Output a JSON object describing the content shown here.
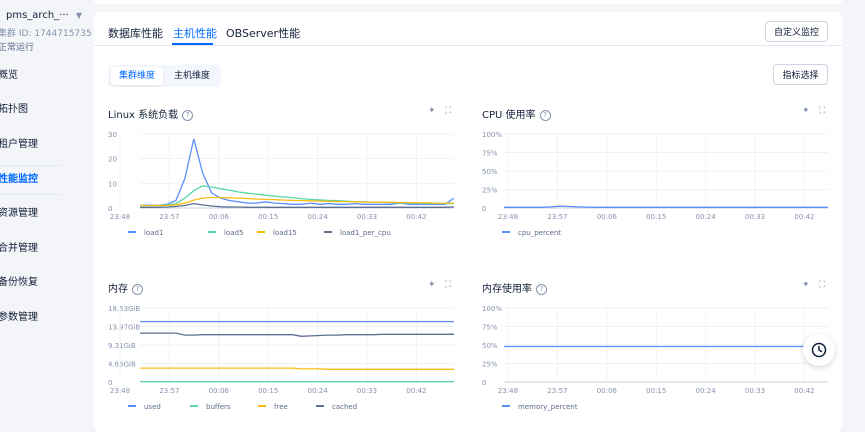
{
  "sidebar": {
    "cluster_name": "pms_arch_···",
    "cluster_id": "集群 ID: 1744715735",
    "cluster_status": "正常运行",
    "items": [
      {
        "label": "概览"
      },
      {
        "label": "拓扑图"
      },
      {
        "label": "租户管理"
      },
      {
        "label": "性能监控",
        "active": true
      },
      {
        "label": "资源管理"
      },
      {
        "label": "合并管理"
      },
      {
        "label": "备份恢复"
      },
      {
        "label": "参数管理"
      }
    ]
  },
  "tabs": {
    "db_perf": "数据库性能",
    "host_perf": "主机性能",
    "observer_perf": "OBServer性能"
  },
  "buttons": {
    "custom_monitor": "自定义监控",
    "metric_select": "指标选择"
  },
  "subtabs": {
    "cluster": "集群维度",
    "host": "主机维度"
  },
  "colors": {
    "accent": "#006aff",
    "series_blue": "#5b8ff9",
    "series_green": "#5ad8a6",
    "series_orange": "#f6bd16",
    "series_dark": "#5d7092"
  },
  "chart_data": [
    {
      "type": "line",
      "title": "Linux 系统负载",
      "x_ticks": [
        "23:48",
        "23:57",
        "00:06",
        "00:15",
        "00:24",
        "00:33",
        "00:42"
      ],
      "y_ticks": [
        "30",
        "20",
        "10",
        "0"
      ],
      "ylim": [
        0,
        30
      ],
      "series": [
        {
          "name": "load1",
          "color": "#5b8ff9",
          "values": [
            1,
            1.2,
            1,
            1.5,
            3,
            12,
            28,
            14,
            6,
            4,
            3,
            2.5,
            2,
            2,
            2.5,
            2,
            1.8,
            1.5,
            1.5,
            2,
            1.5,
            1.8,
            1.5,
            1.5,
            1.8,
            1.5,
            1.5,
            1.5,
            1.5,
            2,
            1.5,
            1.5,
            1.5,
            1.5,
            1.5,
            4
          ]
        },
        {
          "name": "load5",
          "color": "#5ad8a6",
          "values": [
            1,
            1,
            1,
            1.2,
            1.8,
            4,
            7,
            9,
            8.5,
            7.8,
            7.2,
            6.5,
            6,
            5.6,
            5.2,
            4.8,
            4.5,
            4.2,
            3.8,
            3.5,
            3.3,
            3.1,
            3,
            2.8,
            2.6,
            2.5,
            2.4,
            2.3,
            2.2,
            2.1,
            2,
            2,
            1.9,
            1.9,
            1.8,
            1.8
          ]
        },
        {
          "name": "load15",
          "color": "#f6bd16",
          "values": [
            1,
            1,
            1,
            1,
            1.3,
            2,
            3.2,
            4,
            4.3,
            4.2,
            4.1,
            4,
            3.8,
            3.6,
            3.5,
            3.4,
            3.2,
            3.1,
            3,
            2.9,
            2.8,
            2.7,
            2.6,
            2.6,
            2.5,
            2.4,
            2.4,
            2.3,
            2.3,
            2.2,
            2.2,
            2.1,
            2.1,
            2,
            2,
            2
          ]
        },
        {
          "name": "load1_per_cpu",
          "color": "#5d7092",
          "values": [
            0.3,
            0.3,
            0.3,
            0.4,
            0.6,
            1,
            1.8,
            1.2,
            0.8,
            0.5,
            0.4,
            0.4,
            0.3,
            0.3,
            0.3,
            0.3,
            0.3,
            0.3,
            0.3,
            0.3,
            0.3,
            0.3,
            0.3,
            0.3,
            0.3,
            0.3,
            0.3,
            0.3,
            0.3,
            0.3,
            0.3,
            0.3,
            0.3,
            0.3,
            0.3,
            0.4
          ]
        }
      ]
    },
    {
      "type": "line",
      "title": "CPU 使用率",
      "x_ticks": [
        "23:48",
        "23:57",
        "00:06",
        "00:15",
        "00:24",
        "00:33",
        "00:42"
      ],
      "y_ticks": [
        "100%",
        "75%",
        "50%",
        "25%",
        "0"
      ],
      "ylim": [
        0,
        100
      ],
      "series": [
        {
          "name": "cpu_percent",
          "color": "#5b8ff9",
          "values": [
            1,
            1,
            1,
            1,
            1,
            1.5,
            2.5,
            2,
            1.5,
            1.2,
            1,
            1,
            1,
            1,
            1,
            1,
            1,
            1,
            1,
            1,
            1,
            1,
            1,
            1,
            1,
            1,
            1,
            1,
            1,
            1,
            1,
            1,
            1,
            1,
            1,
            1
          ]
        }
      ]
    },
    {
      "type": "line",
      "title": "内存",
      "x_ticks": [
        "23:48",
        "23:57",
        "00:06",
        "00:15",
        "00:24",
        "00:33",
        "00:42"
      ],
      "y_ticks": [
        "18.63GiB",
        "13.97GiB",
        "9.31GiB",
        "4.66GiB",
        "0"
      ],
      "ylim": [
        0,
        18.63
      ],
      "series": [
        {
          "name": "used",
          "color": "#5b8ff9",
          "values": [
            15.2,
            15.2,
            15.2,
            15.2,
            15.2,
            15.2,
            15.2,
            15.2,
            15.2,
            15.2,
            15.2,
            15.2,
            15.2,
            15.2,
            15.2,
            15.2,
            15.2,
            15.2,
            15.2,
            15.2,
            15.2,
            15.2,
            15.2,
            15.2,
            15.2,
            15.2,
            15.2,
            15.2,
            15.2,
            15.2,
            15.2,
            15.2,
            15.2,
            15.2,
            15.2,
            15.2
          ]
        },
        {
          "name": "buffers",
          "color": "#5ad8a6",
          "values": [
            0.1,
            0.1,
            0.1,
            0.1,
            0.1,
            0.1,
            0.1,
            0.1,
            0.1,
            0.1,
            0.1,
            0.1,
            0.1,
            0.1,
            0.1,
            0.1,
            0.1,
            0.1,
            0.1,
            0.1,
            0.1,
            0.1,
            0.1,
            0.1,
            0.1,
            0.1,
            0.1,
            0.1,
            0.1,
            0.1,
            0.1,
            0.1,
            0.1,
            0.1,
            0.1,
            0.1
          ]
        },
        {
          "name": "free",
          "color": "#f6bd16",
          "values": [
            3.5,
            3.5,
            3.5,
            3.5,
            3.5,
            3.5,
            3.5,
            3.5,
            3.5,
            3.5,
            3.5,
            3.5,
            3.5,
            3.5,
            3.5,
            3.5,
            3.5,
            3.5,
            3.3,
            3.3,
            3.3,
            3.2,
            3.2,
            3.2,
            3.2,
            3.2,
            3.2,
            3.2,
            3.2,
            3.2,
            3.2,
            3.2,
            3.2,
            3.2,
            3.2,
            3.2
          ]
        },
        {
          "name": "cached",
          "color": "#5d7092",
          "values": [
            12.3,
            12.3,
            12.3,
            12.3,
            12.3,
            11.8,
            11.8,
            11.9,
            11.9,
            11.9,
            11.9,
            11.9,
            11.9,
            11.9,
            11.9,
            11.9,
            11.9,
            11.9,
            11.5,
            11.6,
            11.7,
            11.8,
            11.8,
            11.9,
            11.9,
            11.9,
            11.9,
            12,
            12,
            12,
            12,
            12,
            12,
            12,
            12,
            12
          ]
        }
      ]
    },
    {
      "type": "line",
      "title": "内存使用率",
      "x_ticks": [
        "23:48",
        "23:57",
        "00:06",
        "00:15",
        "00:24",
        "00:33",
        "00:42"
      ],
      "y_ticks": [
        "100%",
        "75%",
        "50%",
        "25%",
        "0"
      ],
      "ylim": [
        0,
        100
      ],
      "series": [
        {
          "name": "memory_percent",
          "color": "#5b8ff9",
          "values": [
            48,
            48,
            48,
            48,
            48,
            48,
            48,
            48,
            48,
            48,
            48,
            48,
            48,
            48,
            48,
            48,
            48,
            48,
            48,
            48,
            48,
            48,
            48,
            48,
            48,
            48,
            48,
            48,
            48,
            48,
            48,
            48,
            48,
            48,
            48,
            48
          ]
        }
      ]
    }
  ]
}
